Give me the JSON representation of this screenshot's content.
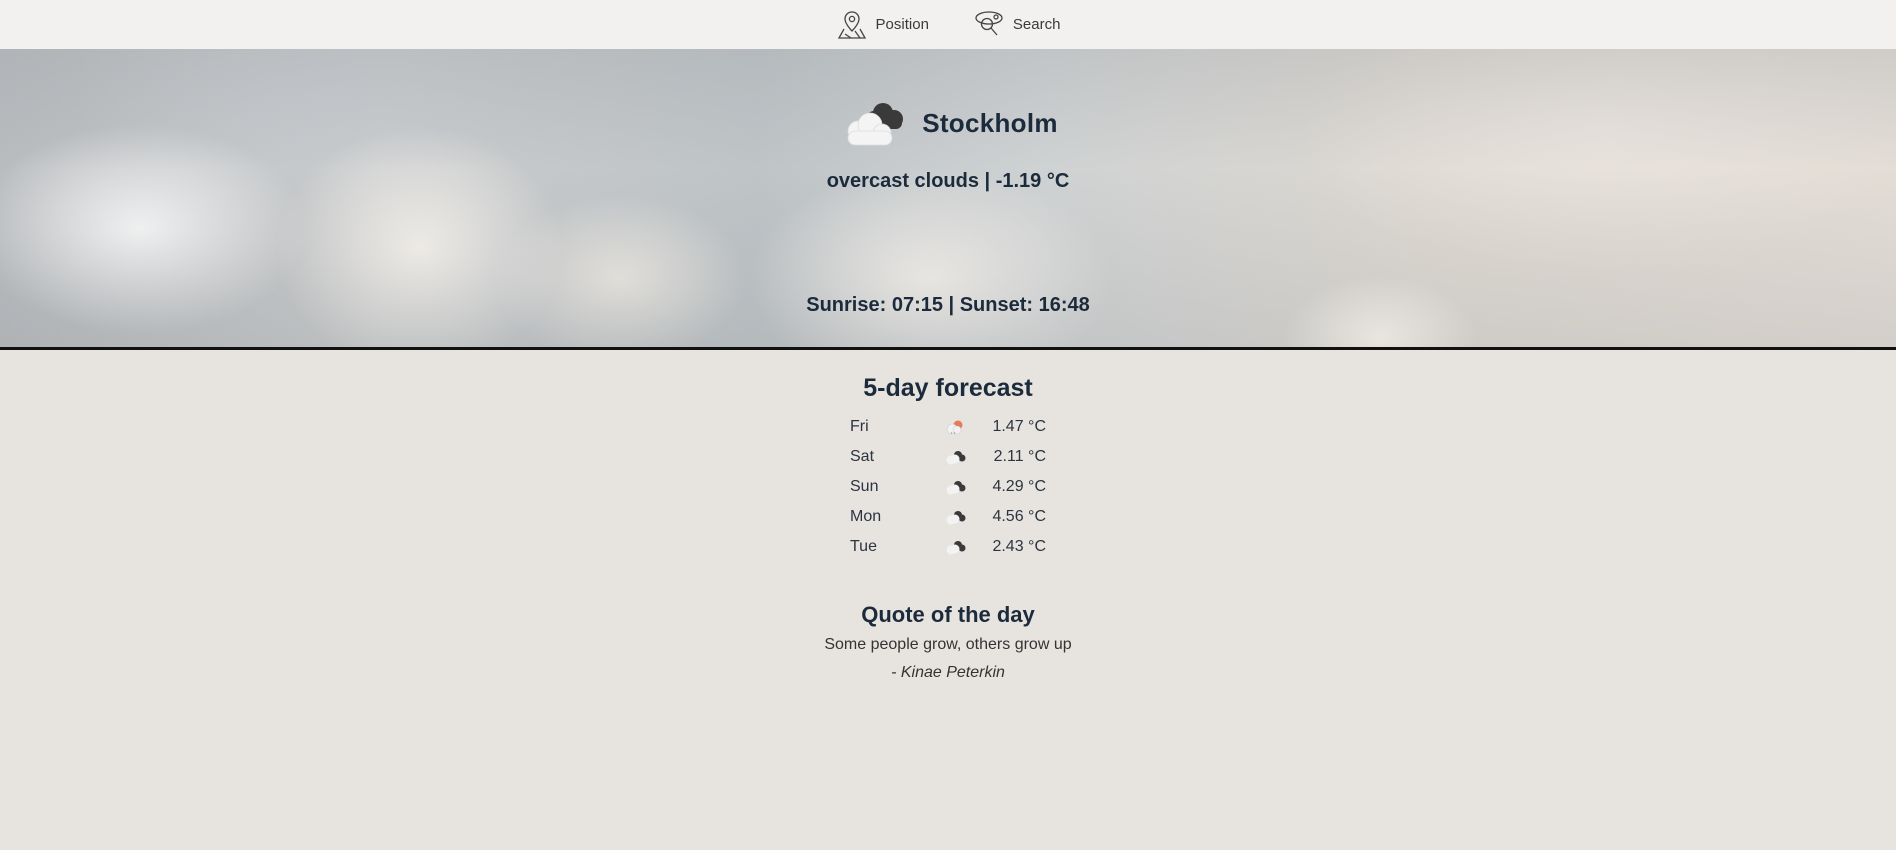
{
  "nav": {
    "items": [
      {
        "label": "Position",
        "icon": "map-pin-icon"
      },
      {
        "label": "Search",
        "icon": "search-location-icon"
      }
    ]
  },
  "current": {
    "city": "Stockholm",
    "icon": "overcast-clouds-icon",
    "summary": "overcast clouds | -1.19 °C",
    "sun": "Sunrise: 07:15 |  Sunset: 16:48"
  },
  "forecast": {
    "title": "5-day forecast",
    "days": [
      {
        "day": "Fri",
        "icon": "cloud-sun-icon",
        "temp": "1.47 °C"
      },
      {
        "day": "Sat",
        "icon": "cloud-icon",
        "temp": "2.11 °C"
      },
      {
        "day": "Sun",
        "icon": "cloud-icon",
        "temp": "4.29 °C"
      },
      {
        "day": "Mon",
        "icon": "cloud-icon",
        "temp": "4.56 °C"
      },
      {
        "day": "Tue",
        "icon": "cloud-icon",
        "temp": "2.43 °C"
      }
    ]
  },
  "quote": {
    "title": "Quote of the day",
    "text": "Some people grow, others grow up",
    "author": "- Kinae Peterkin"
  },
  "colors": {
    "page_bg": "#e7e4df",
    "nav_bg": "#f2f1ef",
    "text_dark": "#1c2b3b"
  }
}
